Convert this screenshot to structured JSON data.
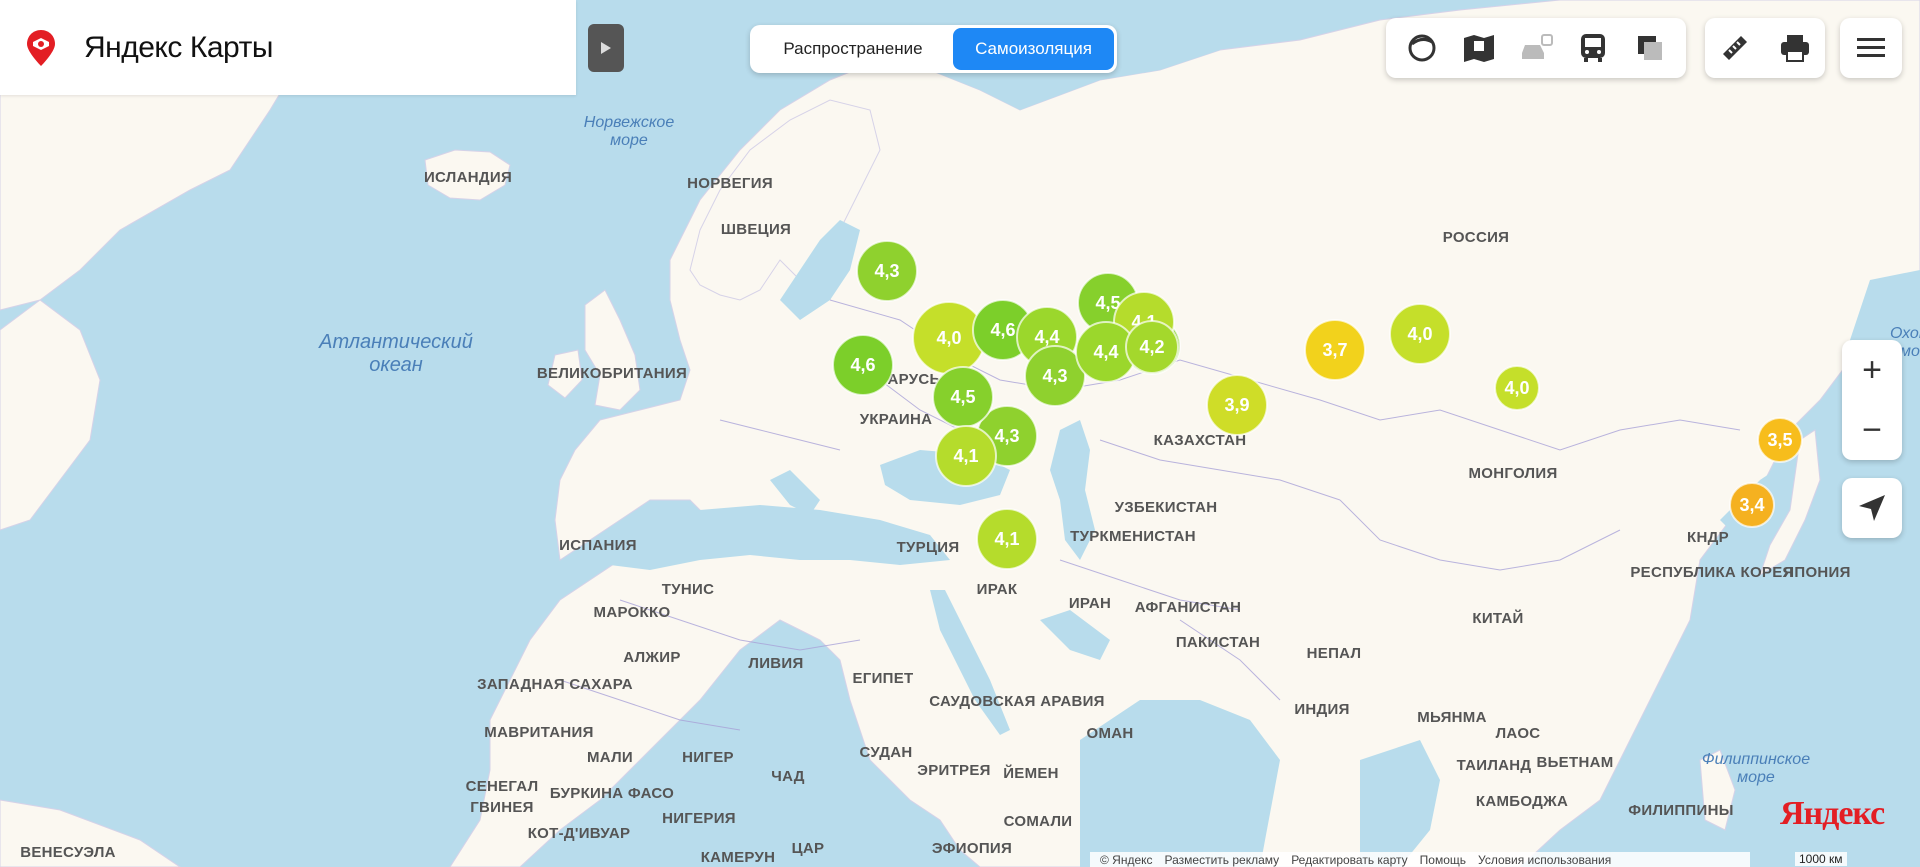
{
  "app": {
    "logo_brand": "Яндекс",
    "logo_product": "Карты"
  },
  "modes": {
    "spread_label": "Распространение",
    "isolation_label": "Самоизоляция",
    "active": "isolation"
  },
  "layers": [
    {
      "icon": "circle-layers-icon"
    },
    {
      "icon": "map-book-icon"
    },
    {
      "icon": "traffic-car-icon"
    },
    {
      "icon": "bus-transport-icon"
    },
    {
      "icon": "panorama-layers-icon"
    }
  ],
  "tools": [
    {
      "icon": "ruler-icon"
    },
    {
      "icon": "printer-icon"
    }
  ],
  "menu_icon": "hamburger-menu-icon",
  "zoom": {
    "in_label": "+",
    "out_label": "−"
  },
  "seas": [
    {
      "id": "norwegian",
      "lines": [
        "Норвежское",
        "море"
      ]
    },
    {
      "id": "atlantic",
      "lines": [
        "Атлантический",
        "океан"
      ]
    },
    {
      "id": "okhotsk",
      "lines": [
        "Охотск",
        "мо"
      ]
    },
    {
      "id": "philippine",
      "lines": [
        "Филиппинское",
        "море"
      ]
    }
  ],
  "countries": [
    {
      "id": "iceland",
      "name": "ИСЛАНДИЯ"
    },
    {
      "id": "norway",
      "name": "НОРВЕГИЯ"
    },
    {
      "id": "sweden",
      "name": "ШВЕЦИЯ"
    },
    {
      "id": "russia",
      "name": "РОССИЯ"
    },
    {
      "id": "uk",
      "name": "ВЕЛИКОБРИТАНИЯ"
    },
    {
      "id": "belarus",
      "name": "БЕЛАРУСЬ"
    },
    {
      "id": "ukraine",
      "name": "УКРАИНА"
    },
    {
      "id": "kazakhstan",
      "name": "КАЗАХСТАН"
    },
    {
      "id": "mongolia",
      "name": "МОНГОЛИЯ"
    },
    {
      "id": "uzbekistan",
      "name": "УЗБЕКИСТАН"
    },
    {
      "id": "turkmenistan",
      "name": "ТУРКМЕНИСТАН"
    },
    {
      "id": "spain",
      "name": "ИСПАНИЯ"
    },
    {
      "id": "turkey",
      "name": "ТУРЦИЯ"
    },
    {
      "id": "tunisia",
      "name": "ТУНИС"
    },
    {
      "id": "morocco",
      "name": "МАРОККО"
    },
    {
      "id": "iraq",
      "name": "ИРАК"
    },
    {
      "id": "iran",
      "name": "ИРАН"
    },
    {
      "id": "afghanistan",
      "name": "АФГАНИСТАН"
    },
    {
      "id": "algeria",
      "name": "АЛЖИР"
    },
    {
      "id": "libya",
      "name": "ЛИВИЯ"
    },
    {
      "id": "pakistan",
      "name": "ПАКИСТАН"
    },
    {
      "id": "china",
      "name": "КИТАЙ"
    },
    {
      "id": "nepal",
      "name": "НЕПАЛ"
    },
    {
      "id": "dprk",
      "name": "КНДР"
    },
    {
      "id": "korea",
      "name": "РЕСПУБЛИКА КОРЕЯ"
    },
    {
      "id": "japan",
      "name": "ЯПОНИЯ"
    },
    {
      "id": "wsahara",
      "name": "ЗАПАДНАЯ САХАРА"
    },
    {
      "id": "egypt",
      "name": "ЕГИПЕТ"
    },
    {
      "id": "saudi",
      "name": "САУДОВСКАЯ АРАВИЯ"
    },
    {
      "id": "india",
      "name": "ИНДИЯ"
    },
    {
      "id": "myanmar",
      "name": "МЬЯНМА"
    },
    {
      "id": "laos",
      "name": "ЛАОС"
    },
    {
      "id": "mauritania",
      "name": "МАВРИТАНИЯ"
    },
    {
      "id": "mali",
      "name": "МАЛИ"
    },
    {
      "id": "niger",
      "name": "НИГЕР"
    },
    {
      "id": "sudan",
      "name": "СУДАН"
    },
    {
      "id": "oman",
      "name": "ОМАН"
    },
    {
      "id": "eritrea",
      "name": "ЭРИТРЕЯ"
    },
    {
      "id": "yemen",
      "name": "ЙЕМЕН"
    },
    {
      "id": "thailand",
      "name": "ТАИЛАНД"
    },
    {
      "id": "vietnam",
      "name": "ВЬЕТНАМ"
    },
    {
      "id": "chad",
      "name": "ЧАД"
    },
    {
      "id": "senegal",
      "name": "СЕНЕГАЛ"
    },
    {
      "id": "guinea",
      "name": "ГВИНЕЯ"
    },
    {
      "id": "burkina",
      "name": "БУРКИНА ФАСО"
    },
    {
      "id": "nigeria",
      "name": "НИГЕРИЯ"
    },
    {
      "id": "cambodia",
      "name": "КАМБОДЖА"
    },
    {
      "id": "philippines",
      "name": "ФИЛИППИНЫ"
    },
    {
      "id": "ivorycoast",
      "name": "КОТ-Д'ИВУАР"
    },
    {
      "id": "somalia",
      "name": "СОМАЛИ"
    },
    {
      "id": "venezuela",
      "name": "ВЕНЕСУЭЛА"
    },
    {
      "id": "cameroon",
      "name": "КАМЕРУН"
    },
    {
      "id": "car",
      "name": "ЦАР"
    },
    {
      "id": "ethiopia",
      "name": "ЭФИОПИЯ"
    }
  ],
  "clusters": [
    {
      "value": "4,3",
      "color": "#8fd12e"
    },
    {
      "value": "4,6",
      "color": "#7ccf2a"
    },
    {
      "value": "4,0",
      "color": "#c5df2a"
    },
    {
      "value": "4,6",
      "color": "#7ccf2a"
    },
    {
      "value": "4,4",
      "color": "#9bd72c"
    },
    {
      "value": "4,5",
      "color": "#86d02c"
    },
    {
      "value": "4,5",
      "color": "#86d02c"
    },
    {
      "value": "4,1",
      "color": "#b5dc2c"
    },
    {
      "value": "4,3",
      "color": "#8fd12e"
    },
    {
      "value": "4,4",
      "color": "#9bd72c"
    },
    {
      "value": "4,2",
      "color": "#a4d82c"
    },
    {
      "value": "4,3",
      "color": "#8fd12e"
    },
    {
      "value": "4,5",
      "color": "#86d02c"
    },
    {
      "value": "4,1",
      "color": "#b5dc2c"
    },
    {
      "value": "4,1",
      "color": "#b5dc2c"
    },
    {
      "value": "3,9",
      "color": "#cfdd28"
    },
    {
      "value": "3,7",
      "color": "#f2d21c"
    },
    {
      "value": "4,0",
      "color": "#c5df2a"
    },
    {
      "value": "4,0",
      "color": "#c5df2a"
    },
    {
      "value": "3,5",
      "color": "#f7bd1c"
    },
    {
      "value": "3,4",
      "color": "#f5b120"
    }
  ],
  "footer": {
    "copyright": "© Яндекс",
    "advertise": "Разместить рекламу",
    "edit_map": "Редактировать карту",
    "help": "Помощь",
    "terms": "Условия использования",
    "scale": "1000 км",
    "watermark": "Яндекс"
  },
  "colors": {
    "accent": "#1e88f5",
    "water": "#aad3df",
    "land": "#fbf8f1",
    "brand": "#e31e24"
  }
}
